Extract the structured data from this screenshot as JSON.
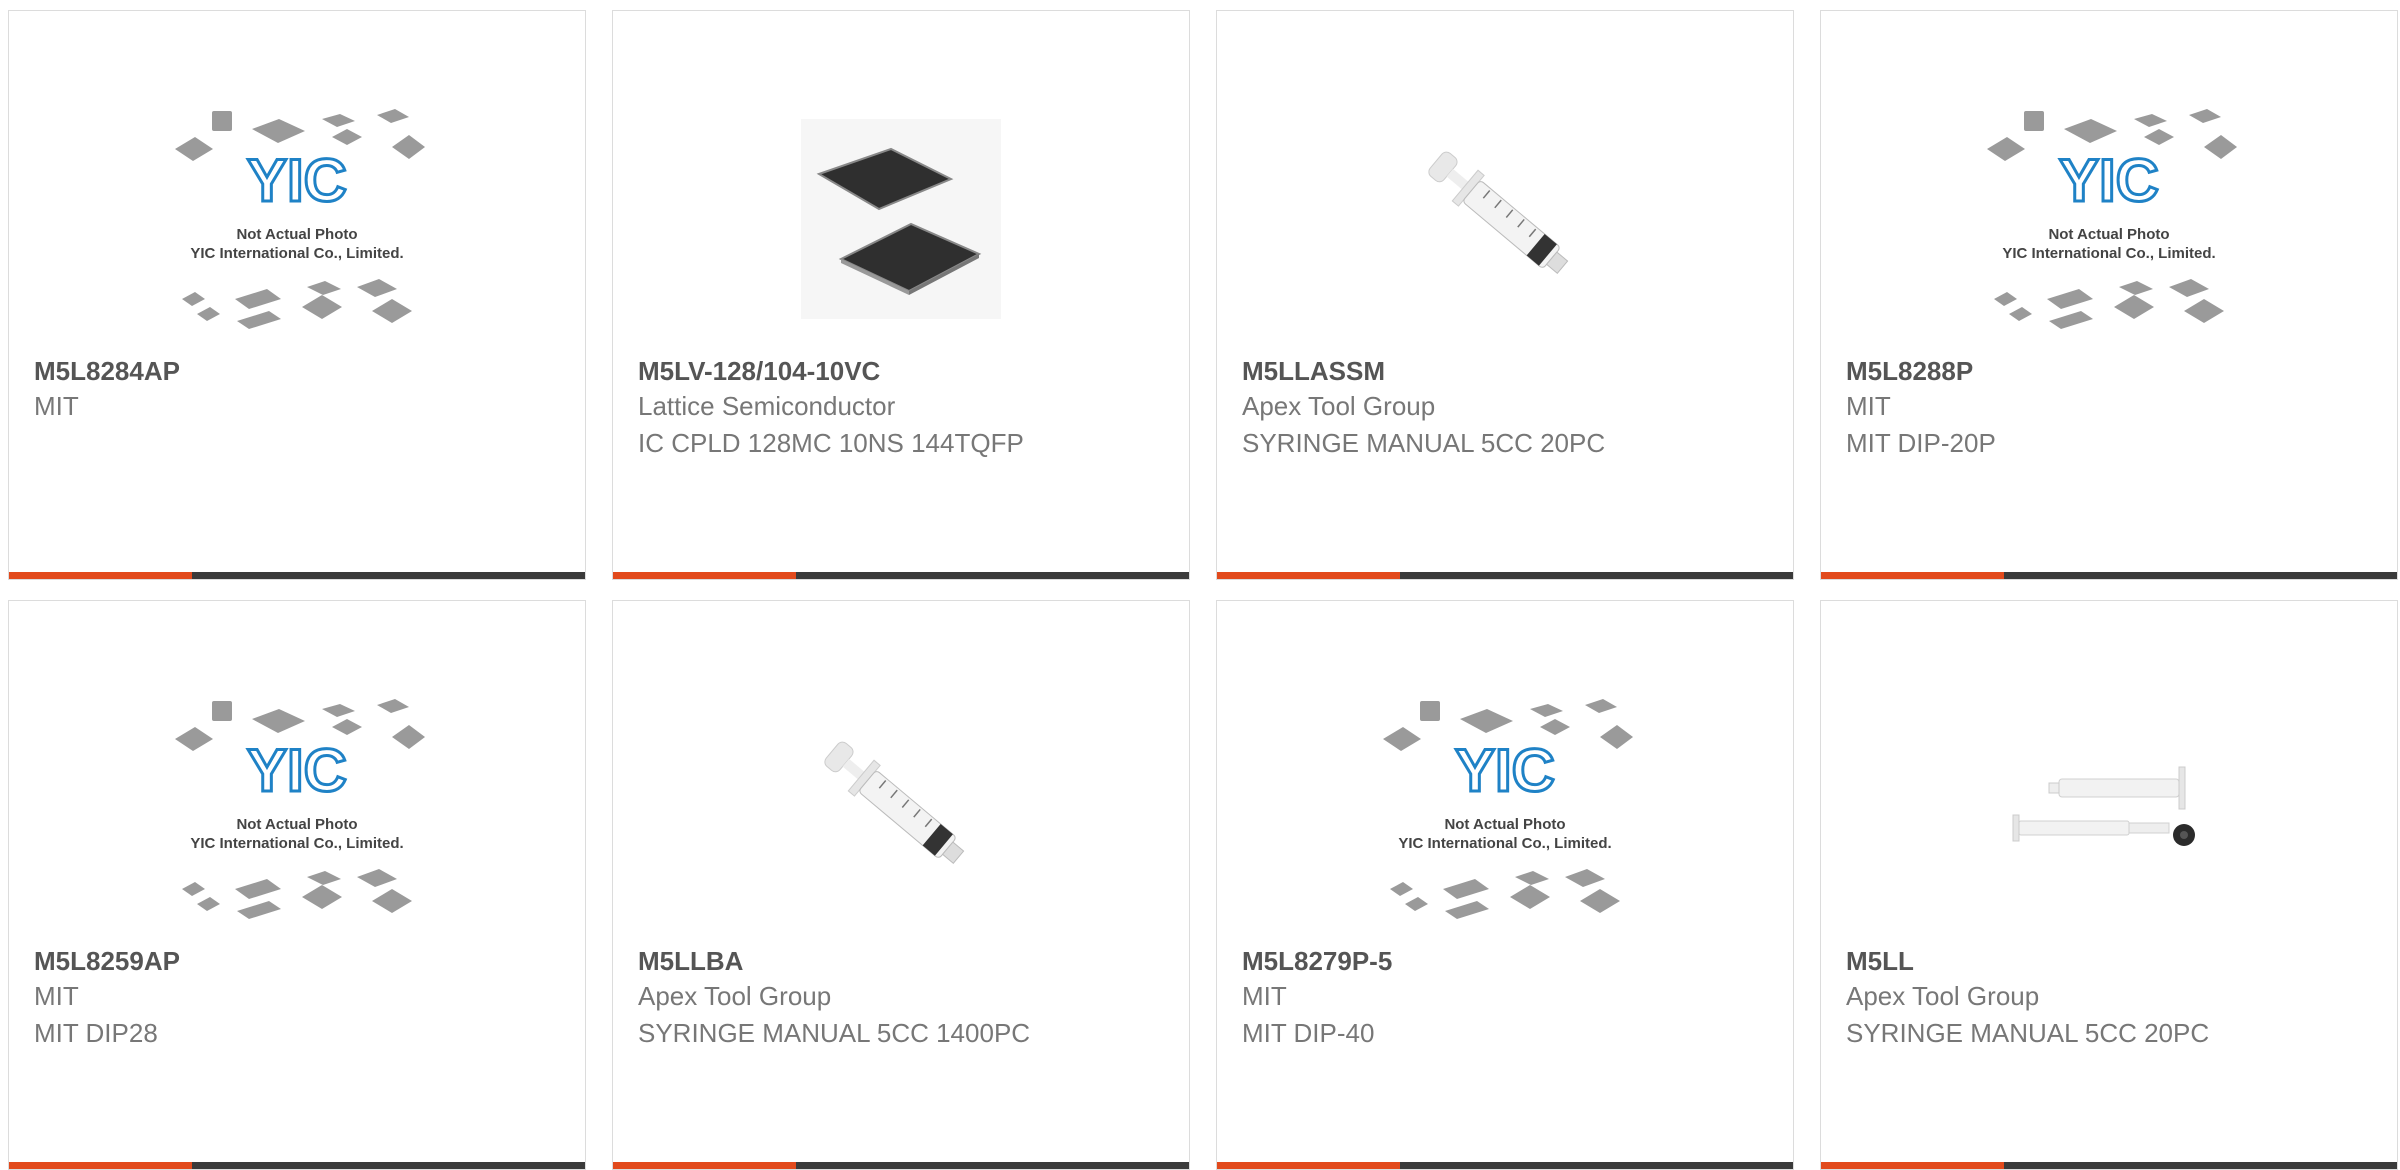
{
  "colors": {
    "accent": "#e24a1c",
    "bar": "#3a3a3a",
    "yic_blue": "#1f82c6"
  },
  "placeholder": {
    "line1": "Not Actual Photo",
    "line2": "YIC International Co., Limited.",
    "logo": "YIC"
  },
  "products": [
    {
      "part_number": "M5L8284AP",
      "manufacturer": "MIT",
      "description": "",
      "image": "yic-placeholder-icon"
    },
    {
      "part_number": "M5LV-128/104-10VC",
      "manufacturer": "Lattice Semiconductor",
      "description": "IC CPLD 128MC 10NS 144TQFP",
      "image": "tqfp-chip-icon"
    },
    {
      "part_number": "M5LLASSM",
      "manufacturer": "Apex Tool Group",
      "description": "SYRINGE MANUAL 5CC 20PC",
      "image": "syringe-icon"
    },
    {
      "part_number": "M5L8288P",
      "manufacturer": "MIT",
      "description": "MIT DIP-20P",
      "image": "yic-placeholder-icon"
    },
    {
      "part_number": "M5L8259AP",
      "manufacturer": "MIT",
      "description": "MIT DIP28",
      "image": "yic-placeholder-icon"
    },
    {
      "part_number": "M5LLBA",
      "manufacturer": "Apex Tool Group",
      "description": "SYRINGE MANUAL 5CC 1400PC",
      "image": "syringe-icon"
    },
    {
      "part_number": "M5L8279P-5",
      "manufacturer": "MIT",
      "description": "MIT DIP-40",
      "image": "yic-placeholder-icon"
    },
    {
      "part_number": "M5LL",
      "manufacturer": "Apex Tool Group",
      "description": "SYRINGE MANUAL 5CC 20PC",
      "image": "syringe-parts-icon"
    }
  ]
}
